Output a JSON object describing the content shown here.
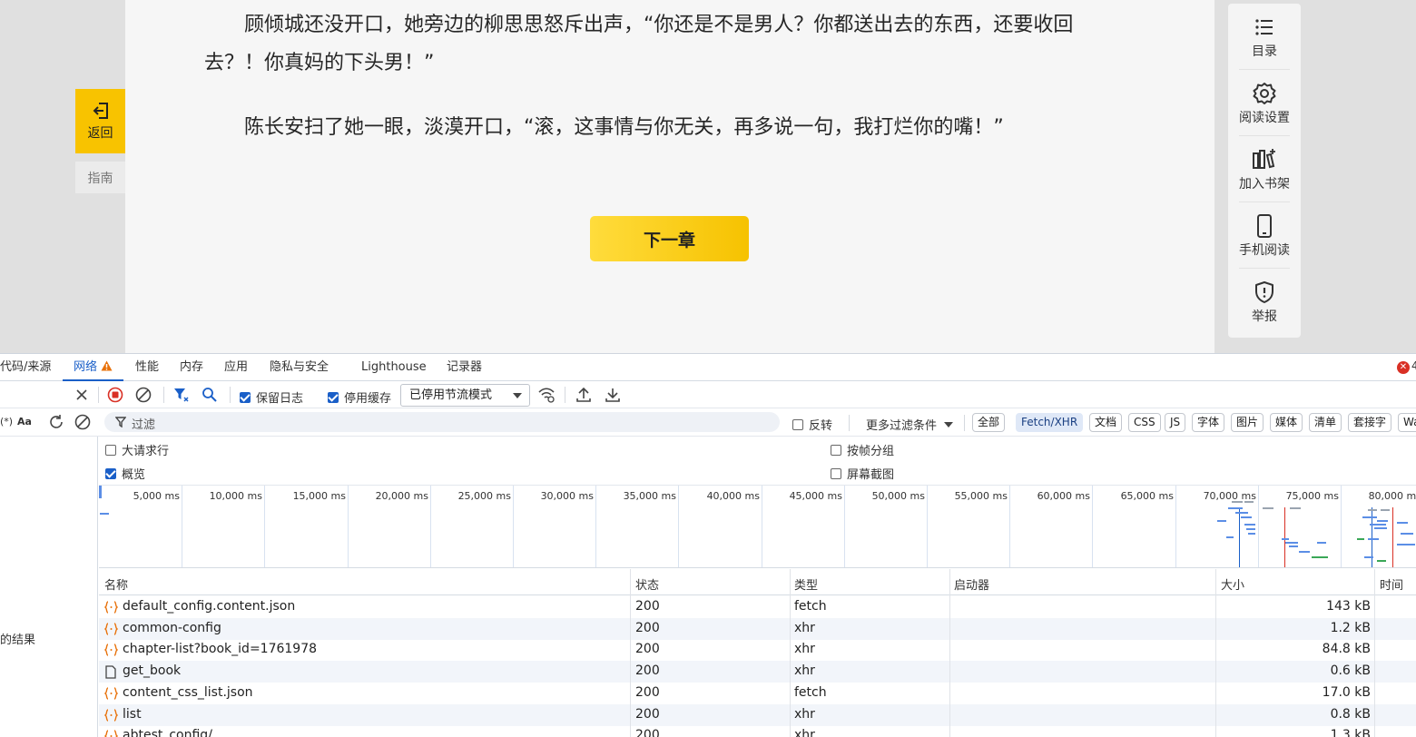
{
  "reader": {
    "paragraphs": [
      "顾倾城还没开口，她旁边的柳思思怒斥出声，“你还是不是男人？你都送出去的东西，还要收回去？！你真妈的下头男！”",
      "陈长安扫了她一眼，淡漠开口，“滚，这事情与你无关，再多说一句，我打烂你的嘴！”"
    ],
    "next_chapter_label": "下一章",
    "back_label": "返回",
    "guide_label": "指南",
    "right_menu": [
      {
        "icon": "list-icon",
        "label": "目录"
      },
      {
        "icon": "gear-icon",
        "label": "阅读设置"
      },
      {
        "icon": "bookshelf-add-icon",
        "label": "加入书架"
      },
      {
        "icon": "phone-icon",
        "label": "手机阅读"
      },
      {
        "icon": "shield-alert-icon",
        "label": "举报"
      }
    ]
  },
  "devtools": {
    "tabs": [
      "代码/来源",
      "网络",
      "性能",
      "内存",
      "应用",
      "隐私与安全",
      "Lighthouse",
      "记录器"
    ],
    "active_tab": "网络",
    "error_count_partial": "4",
    "toolbar": {
      "preserve_log": "保留日志",
      "disable_cache": "停用缓存",
      "throttle_value": "已停用节流模式"
    },
    "filter": {
      "placeholder": "过滤",
      "invert_label": "反转",
      "more_filters": "更多过滤条件",
      "left_case": "Aa",
      "left_regex": "(*)",
      "chips": [
        "全部",
        "Fetch/XHR",
        "文档",
        "CSS",
        "JS",
        "字体",
        "图片",
        "媒体",
        "清单",
        "套接字",
        "Wa"
      ],
      "active_chip": "Fetch/XHR"
    },
    "options": {
      "big_rows": "大请求行",
      "overview": "概览",
      "group_by_frame": "按帧分组",
      "screenshots": "屏幕截图"
    },
    "timeline_ticks": [
      "5,000 ms",
      "10,000 ms",
      "15,000 ms",
      "20,000 ms",
      "25,000 ms",
      "30,000 ms",
      "35,000 ms",
      "40,000 ms",
      "45,000 ms",
      "50,000 ms",
      "55,000 ms",
      "60,000 ms",
      "65,000 ms",
      "70,000 ms",
      "75,000 ms",
      "80,000 ms"
    ],
    "left_panel_result": "的结果",
    "table": {
      "headers": [
        "名称",
        "状态",
        "类型",
        "启动器",
        "大小",
        "时间"
      ],
      "rows": [
        {
          "name": "default_config.content.json",
          "status": "200",
          "type": "fetch",
          "initiator": "",
          "size": "143 kB",
          "icon": "json-icon"
        },
        {
          "name": "common-config",
          "status": "200",
          "type": "xhr",
          "initiator": "",
          "size": "1.2 kB",
          "icon": "json-icon"
        },
        {
          "name": "chapter-list?book_id=1761978",
          "status": "200",
          "type": "xhr",
          "initiator": "",
          "size": "84.8 kB",
          "icon": "json-icon"
        },
        {
          "name": "get_book",
          "status": "200",
          "type": "xhr",
          "initiator": "",
          "size": "0.6 kB",
          "icon": "document-icon"
        },
        {
          "name": "content_css_list.json",
          "status": "200",
          "type": "fetch",
          "initiator": "",
          "size": "17.0 kB",
          "icon": "json-icon"
        },
        {
          "name": "list",
          "status": "200",
          "type": "xhr",
          "initiator": "",
          "size": "0.8 kB",
          "icon": "json-icon"
        },
        {
          "name": "abtest_config/",
          "status": "200",
          "type": "xhr",
          "initiator": "",
          "size": "1.3 kB",
          "icon": "json-icon"
        }
      ]
    }
  }
}
